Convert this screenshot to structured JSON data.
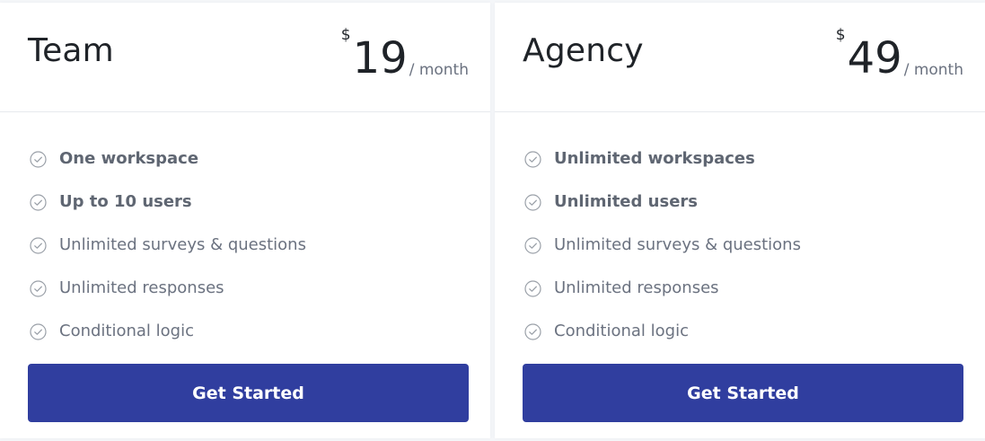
{
  "colors": {
    "accent": "#303e9f",
    "text_dark": "#1f2328",
    "text_muted": "#6b7280",
    "divider": "#e7e9ee"
  },
  "plans": [
    {
      "name": "Team",
      "currency": "$",
      "price": "19",
      "period": "/ month",
      "features": [
        {
          "label": "One workspace",
          "icon": "check-circle-icon"
        },
        {
          "label": "Up to 10 users",
          "icon": "check-circle-icon"
        },
        {
          "label": "Unlimited surveys & questions",
          "icon": "check-circle-icon"
        },
        {
          "label": "Unlimited responses",
          "icon": "check-circle-icon"
        },
        {
          "label": "Conditional logic",
          "icon": "check-circle-icon"
        }
      ],
      "cta_label": "Get Started"
    },
    {
      "name": "Agency",
      "currency": "$",
      "price": "49",
      "period": "/ month",
      "features": [
        {
          "label": "Unlimited workspaces",
          "icon": "check-circle-icon"
        },
        {
          "label": "Unlimited users",
          "icon": "check-circle-icon"
        },
        {
          "label": "Unlimited surveys & questions",
          "icon": "check-circle-icon"
        },
        {
          "label": "Unlimited responses",
          "icon": "check-circle-icon"
        },
        {
          "label": "Conditional logic",
          "icon": "check-circle-icon"
        }
      ],
      "cta_label": "Get Started"
    }
  ]
}
